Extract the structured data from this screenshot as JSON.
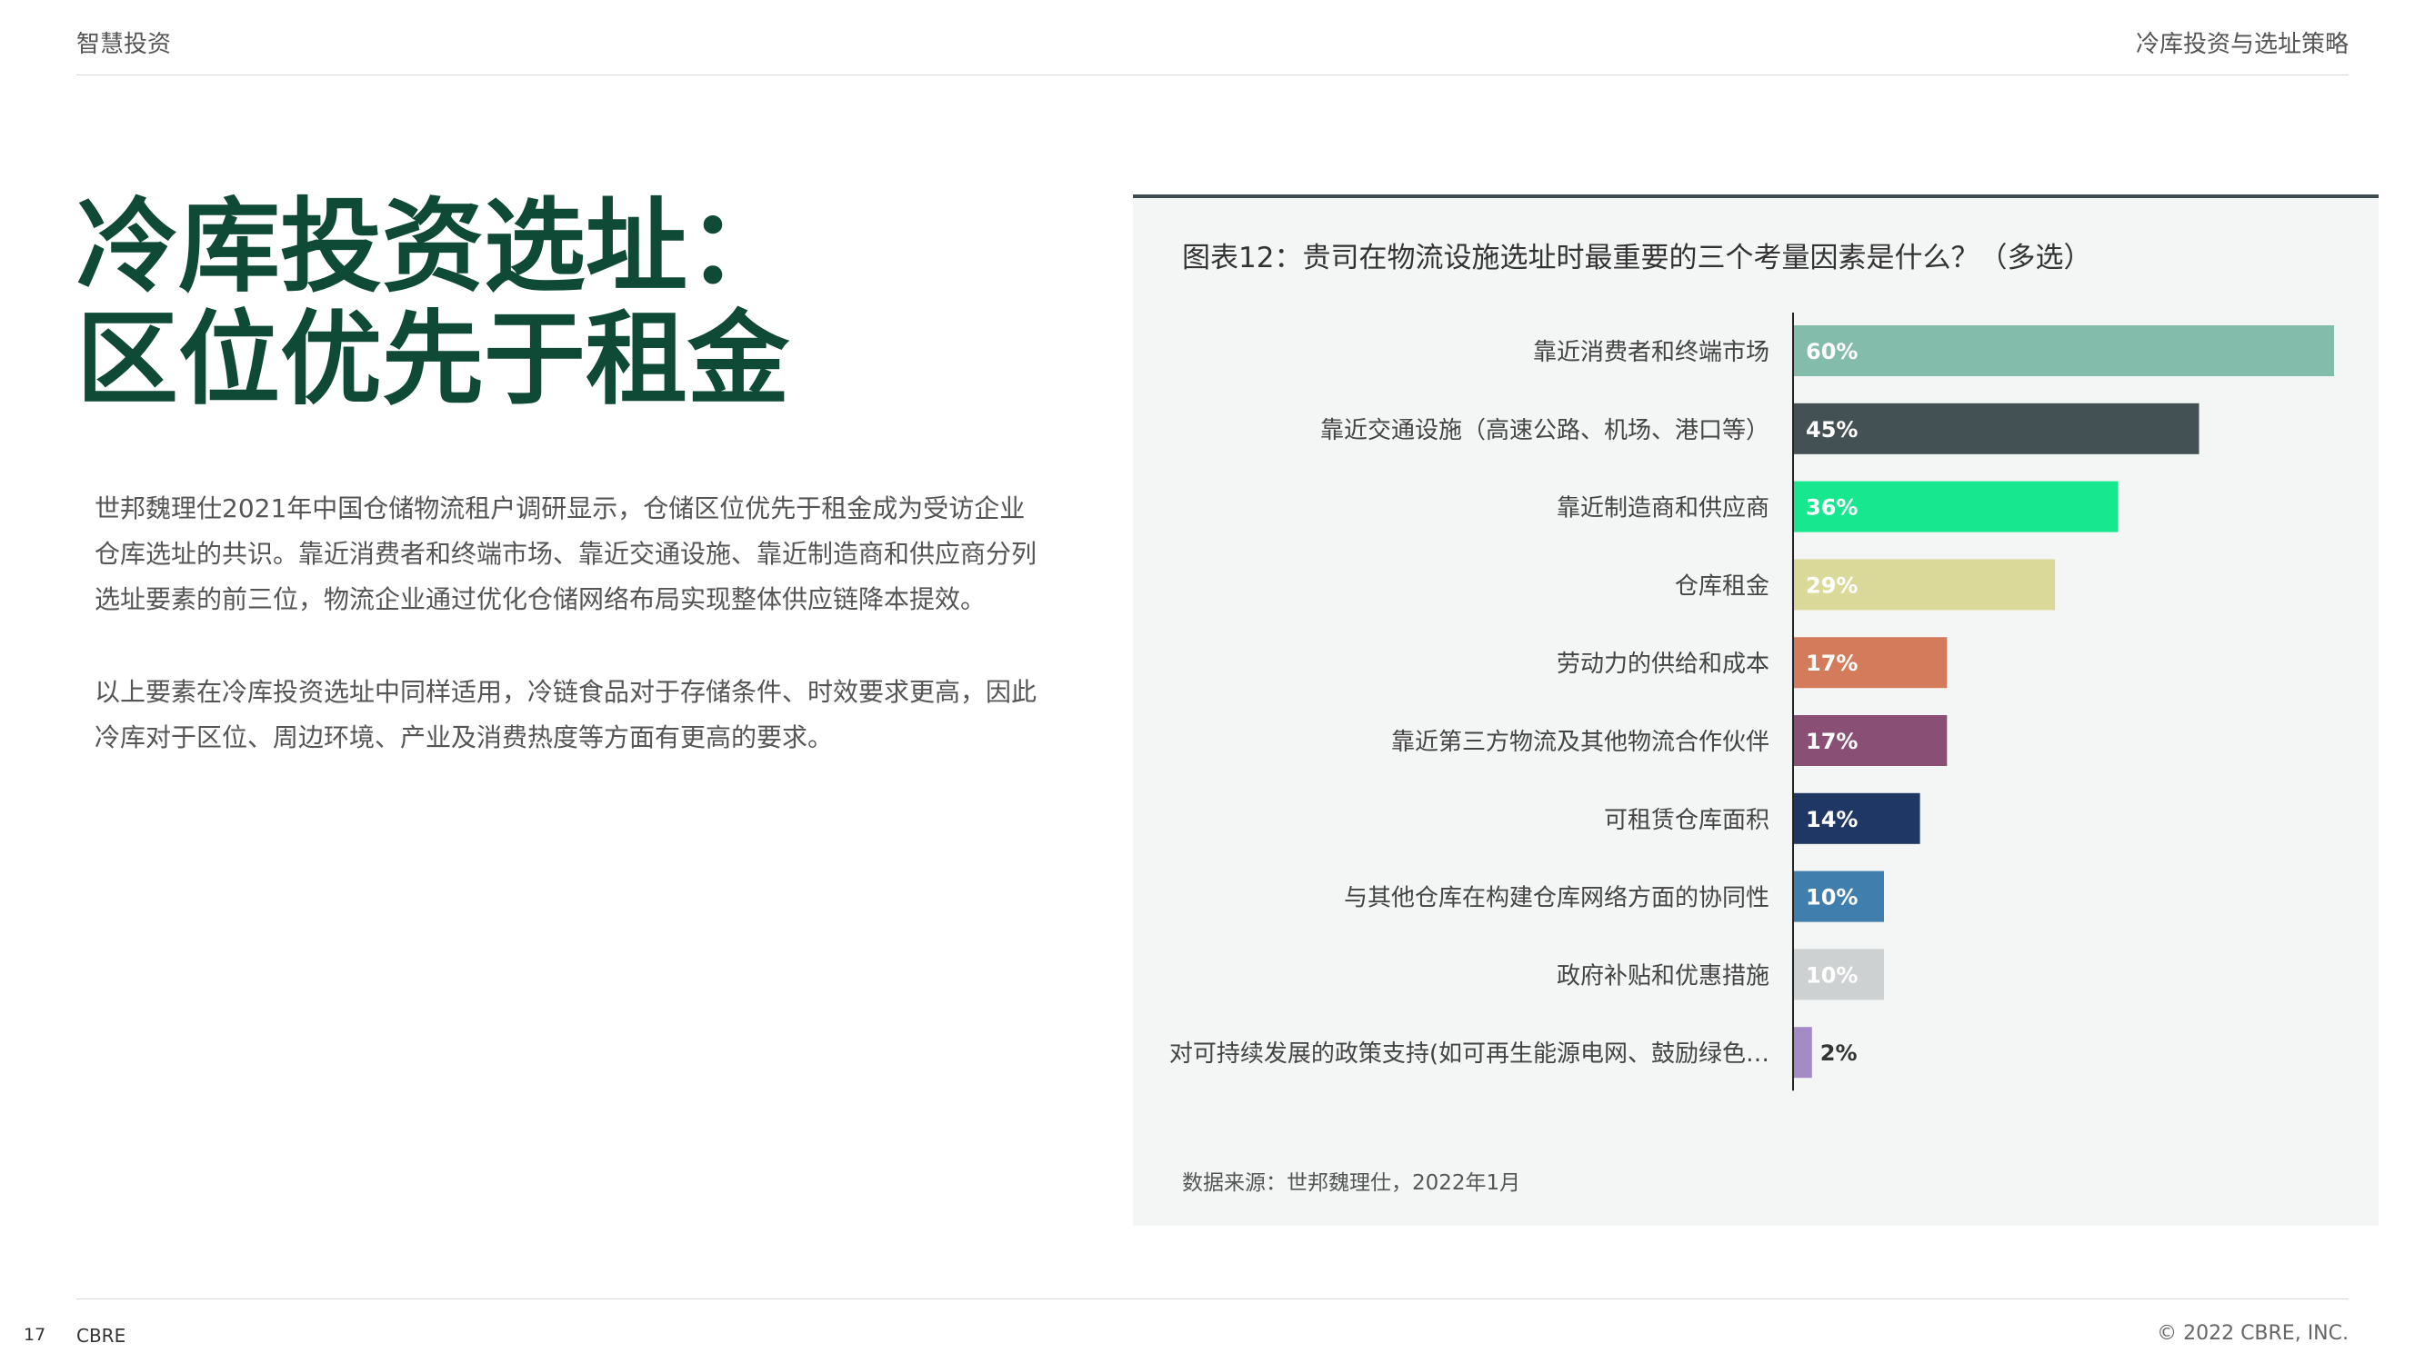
{
  "header": {
    "left": "智慧投资",
    "right": "冷库投资与选址策略"
  },
  "headline": {
    "line1": "冷库投资选址：",
    "line2": "区位优先于租金"
  },
  "body": {
    "paragraph1": "世邦魏理仕2021年中国仓储物流租户调研显示，仓储区位优先于租金成为受访企业仓库选址的共识。靠近消费者和终端市场、靠近交通设施、靠近制造商和供应商分列选址要素的前三位，物流企业通过优化仓储网络布局实现整体供应链降本提效。",
    "paragraph2": "以上要素在冷库投资选址中同样适用，冷链食品对于存储条件、时效要求更高，因此冷库对于区位、周边环境、产业及消费热度等方面有更高的要求。"
  },
  "chart_data": {
    "type": "bar",
    "orientation": "horizontal",
    "title": "图表12：贵司在物流设施选址时最重要的三个考量因素是什么？（多选）",
    "categories": [
      "靠近消费者和终端市场",
      "靠近交通设施（高速公路、机场、港口等）",
      "靠近制造商和供应商",
      "仓库租金",
      "劳动力的供给和成本",
      "靠近第三方物流及其他物流合作伙伴",
      "可租赁仓库面积",
      "与其他仓库在构建仓库网络方面的协同性",
      "政府补贴和优惠措施",
      "对可持续发展的政策支持(如可再生能源电网、鼓励绿色…"
    ],
    "values": [
      60,
      45,
      36,
      29,
      17,
      17,
      14,
      10,
      10,
      2
    ],
    "data_labels": [
      "60%",
      "45%",
      "36%",
      "29%",
      "17%",
      "17%",
      "14%",
      "10%",
      "10%",
      "2%"
    ],
    "colors": [
      "#84bcab",
      "#435155",
      "#17e88f",
      "#dbd99a",
      "#d47b5b",
      "#8a4f74",
      "#1f3764",
      "#3f7ead",
      "#cdd1d1",
      "#a58bc6"
    ],
    "xlim": [
      0,
      60
    ],
    "grid": false,
    "legend": "none",
    "source": "数据来源：世邦魏理仕，2022年1月"
  },
  "footer": {
    "page_number": "17",
    "brand": "CBRE",
    "copyright": "© 2022 CBRE, INC."
  }
}
